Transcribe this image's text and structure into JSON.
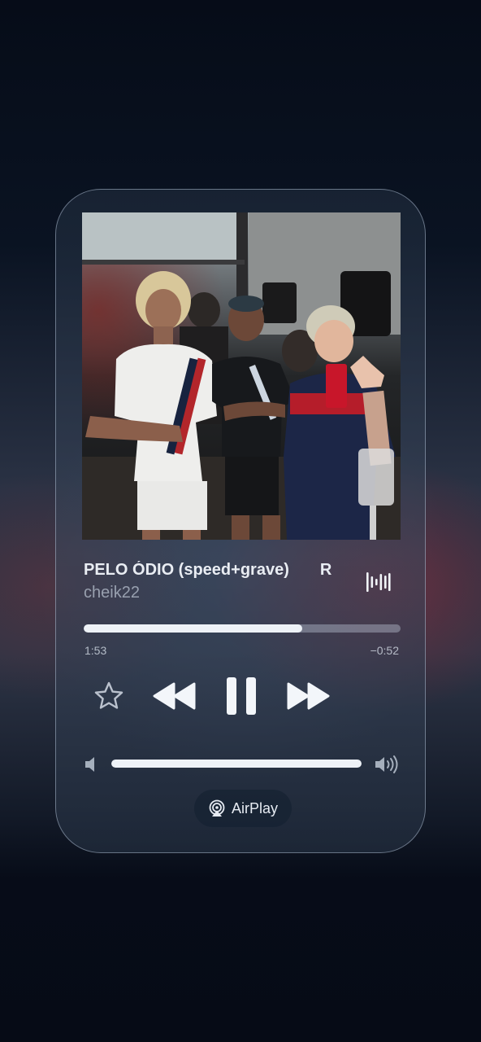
{
  "now_playing": {
    "title": "PELO ÓDIO (speed+grave)",
    "next_title_fragment": "R",
    "artist": "cheik22",
    "artwork_icon": "album-artwork",
    "progress_fraction": 0.69,
    "elapsed": "1:53",
    "remaining": "−0:52"
  },
  "controls": {
    "favorite_icon": "star-icon",
    "previous_icon": "rewind-icon",
    "play_pause_icon": "pause-icon",
    "next_icon": "fast-forward-icon"
  },
  "volume": {
    "level_fraction": 1.0,
    "min_icon": "speaker-low-icon",
    "max_icon": "speaker-high-icon"
  },
  "airplay": {
    "label": "AirPlay",
    "icon": "airplay-icon"
  },
  "colors": {
    "accent": "#eef2f7",
    "track": "#c8d2e1",
    "background": "#07101d"
  }
}
